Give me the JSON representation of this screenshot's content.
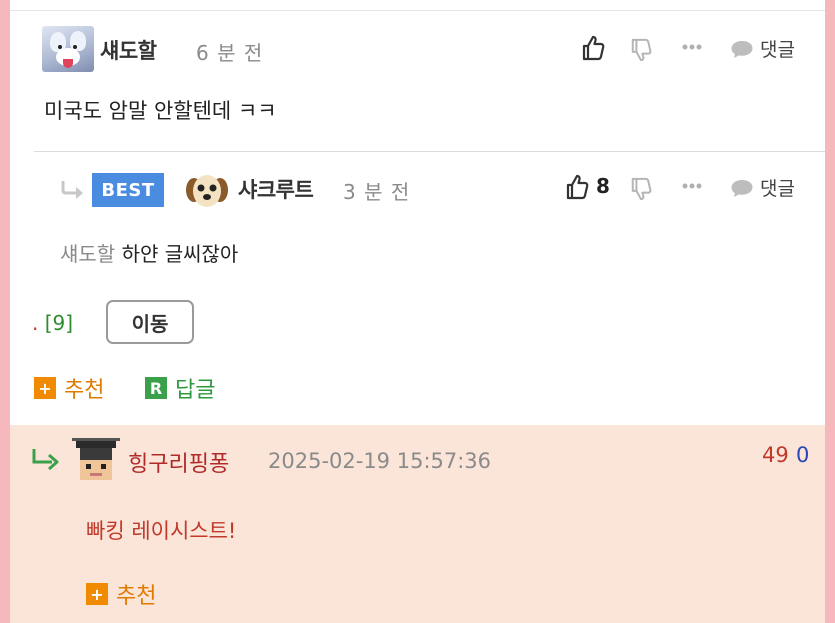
{
  "comment1": {
    "nickname": "섀도할",
    "time": "6 분 전",
    "body": "미국도 암말 안할텐데 ㅋㅋ",
    "reply_label": "댓글",
    "icons": [
      "thumbs-up-icon",
      "thumbs-down-icon",
      "more-icon",
      "speech-bubble-icon"
    ]
  },
  "comment2": {
    "badge": "BEST",
    "nickname": "샤크루트",
    "time": "3 분 전",
    "like_count": "8",
    "mention": "섀도할",
    "body": "하얀 글씨잖아",
    "reply_label": "댓글"
  },
  "nav": {
    "page_dot": ".",
    "page_count": "[9]",
    "goto_label": "이동"
  },
  "actions": {
    "recommend_label": "추천",
    "recommend_icon": "+",
    "reply_label": "답글",
    "reply_icon": "R"
  },
  "reply_comment": {
    "nickname": "힝구리핑퐁",
    "date": "2025-02-19 15:57:36",
    "upvotes": "49",
    "downvotes": "0",
    "body": "빠킹 레이시스트!",
    "recommend_label": "추천",
    "recommend_icon": "+"
  },
  "colors": {
    "background_pink": "#f7b8bd",
    "best_badge": "#4a8de0",
    "reply_panel": "#fbe5d8",
    "recommend_orange": "#f08a00",
    "reply_green": "#3aa14a",
    "nick_red": "#b02a2a"
  }
}
